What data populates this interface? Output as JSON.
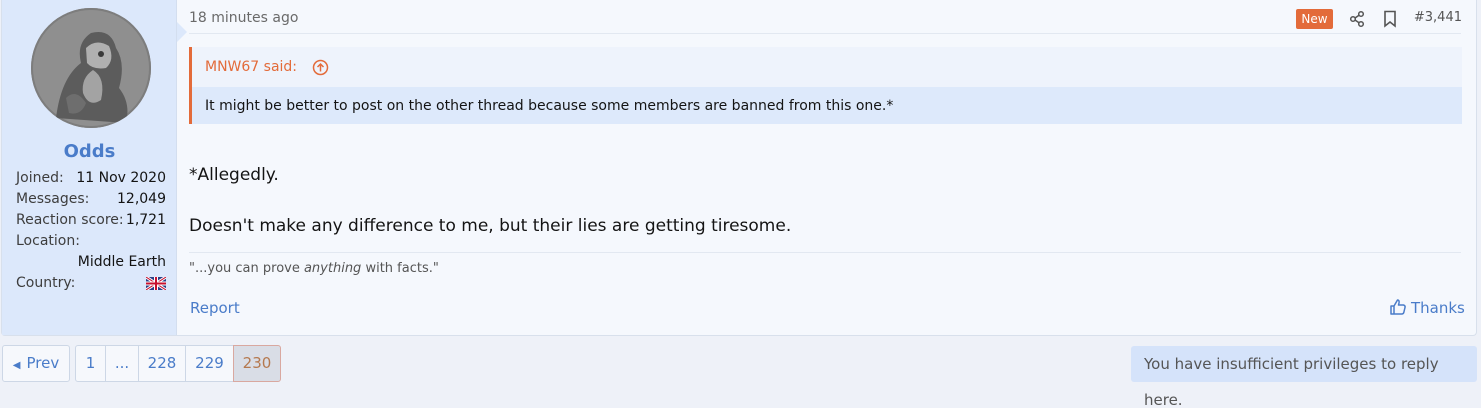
{
  "user": {
    "name": "Odds",
    "stats": [
      {
        "label": "Joined:",
        "value": "11 Nov 2020"
      },
      {
        "label": "Messages:",
        "value": "12,049"
      },
      {
        "label": "Reaction score:",
        "value": "1,721"
      },
      {
        "label": "Location:",
        "value": ""
      }
    ],
    "location_value": "Middle Earth",
    "country_label": "Country:",
    "country_icon": "uk-flag-icon"
  },
  "post": {
    "time": "18 minutes ago",
    "new_badge": "New",
    "number": "#3,441",
    "quote_author": "MNW67 said:",
    "quote_text": "It might be better to post on the other thread because some members are banned from this one.*",
    "lines": [
      "*Allegedly.",
      "Doesn't make any difference to me, but their lies are getting tiresome."
    ],
    "signature_pre": "\"...you can prove ",
    "signature_em": "anything",
    "signature_post": " with facts.\"",
    "report_label": "Report",
    "thanks_label": "Thanks"
  },
  "pagination": {
    "prev_label": "Prev",
    "pages": [
      "1",
      "...",
      "228",
      "229",
      "230"
    ],
    "current": "230"
  },
  "notice": "You have insufficient privileges to reply here.",
  "colors": {
    "accent": "#4a7cc9",
    "new_badge": "#e36b3a",
    "user_bg": "#dce8fb"
  }
}
